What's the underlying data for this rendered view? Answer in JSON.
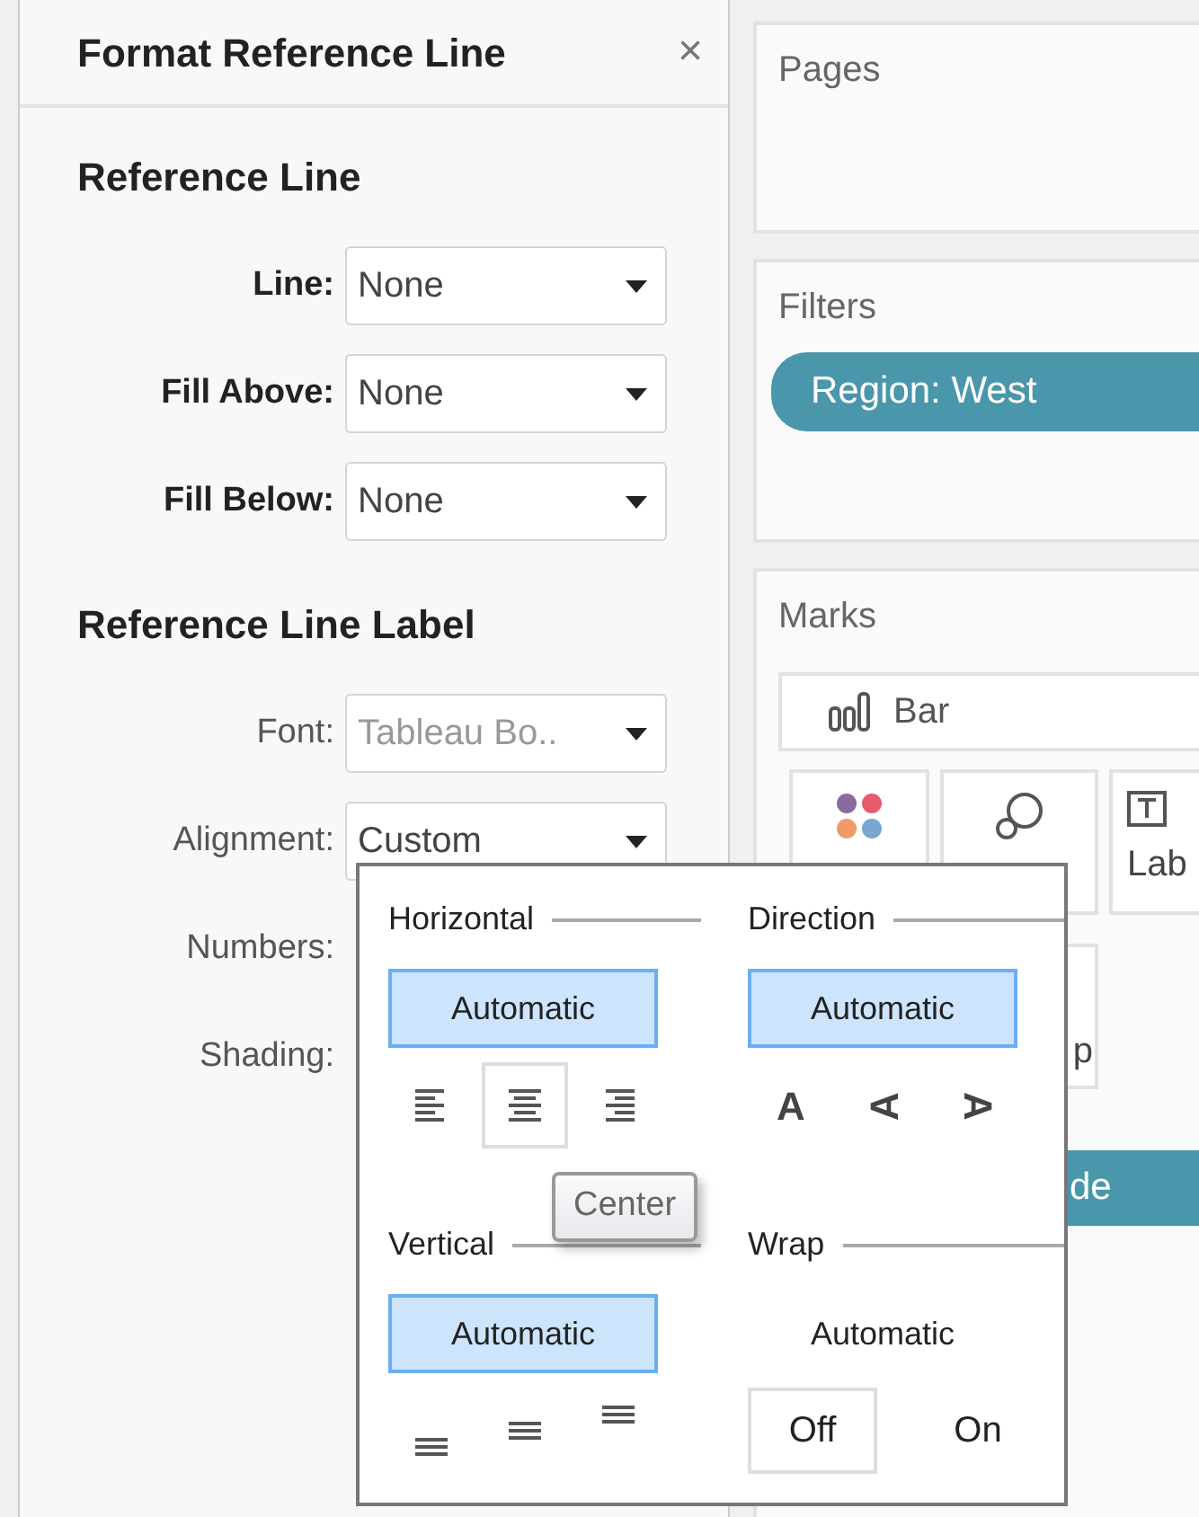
{
  "panel": {
    "title": "Format Reference Line",
    "close": "×"
  },
  "sections": [
    {
      "heading": "Reference Line",
      "bold_labels": true,
      "fields": [
        {
          "label": "Line:",
          "kind": "dropdown",
          "value": "None",
          "disabled": false
        },
        {
          "label": "Fill Above:",
          "kind": "dropdown",
          "value": "None",
          "disabled": false
        },
        {
          "label": "Fill Below:",
          "kind": "dropdown",
          "value": "None",
          "disabled": false
        }
      ]
    },
    {
      "heading": "Reference Line Label",
      "bold_labels": false,
      "fields": [
        {
          "label": "Font:",
          "kind": "dropdown",
          "value": "Tableau Bo..",
          "disabled": true
        },
        {
          "label": "Alignment:",
          "kind": "dropdown",
          "value": "Custom",
          "disabled": false
        },
        {
          "label": "Numbers:",
          "kind": "label"
        },
        {
          "label": "Shading:",
          "kind": "label"
        }
      ]
    }
  ],
  "shelves": {
    "pages": {
      "title": "Pages"
    },
    "filters": {
      "title": "Filters",
      "pills": [
        "Region: West"
      ]
    },
    "marks": {
      "title": "Marks",
      "mark_type": "Bar",
      "cards": [
        {
          "kind": "color"
        },
        {
          "kind": "size"
        },
        {
          "kind": "label",
          "label": "Lab"
        },
        {
          "kind": "tooltip",
          "label": "p"
        }
      ],
      "pills": [
        "de"
      ]
    }
  },
  "alignment_popup": {
    "groups": [
      {
        "title": "Horizontal",
        "mode": {
          "label": "Automatic",
          "selected": true
        },
        "options": [
          {
            "kind": "align-left",
            "outlined": false
          },
          {
            "kind": "align-center",
            "outlined": true
          },
          {
            "kind": "align-right",
            "outlined": false
          }
        ]
      },
      {
        "title": "Direction",
        "mode": {
          "label": "Automatic",
          "selected": true
        },
        "options": [
          {
            "kind": "upright",
            "label": "A",
            "outlined": false
          },
          {
            "kind": "rotate-left",
            "label": "A",
            "outlined": false
          },
          {
            "kind": "rotate-right",
            "label": "A",
            "outlined": false
          }
        ]
      },
      {
        "title": "Vertical",
        "mode": {
          "label": "Automatic",
          "selected": true
        },
        "options": [
          {
            "kind": "align-bottom",
            "outlined": false
          },
          {
            "kind": "align-middle",
            "outlined": false
          },
          {
            "kind": "align-top",
            "outlined": false
          }
        ]
      },
      {
        "title": "Wrap",
        "mode": {
          "label": "Automatic",
          "selected": false
        },
        "options": [
          {
            "kind": "text",
            "label": "Off",
            "outlined": true
          },
          {
            "kind": "text",
            "label": "On",
            "outlined": false
          }
        ]
      }
    ],
    "tooltip": "Center"
  }
}
